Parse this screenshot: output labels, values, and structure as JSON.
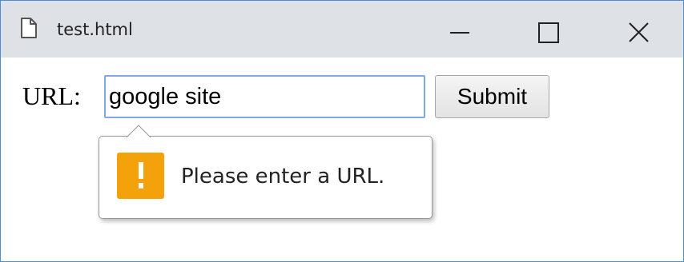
{
  "window": {
    "title": "test.html",
    "controls": {
      "minimize_icon": "minimize-icon",
      "maximize_icon": "maximize-icon",
      "close_icon": "close-icon"
    }
  },
  "form": {
    "url_label": "URL:",
    "url_value": "google site",
    "submit_label": "Submit"
  },
  "validation": {
    "message": "Please enter a URL.",
    "icon": "warning-icon",
    "icon_color": "#f3a20b"
  },
  "colors": {
    "titlebar_bg": "#dee1e6",
    "window_border": "#4a8fd9",
    "input_focus_border": "#7fa8e6"
  }
}
